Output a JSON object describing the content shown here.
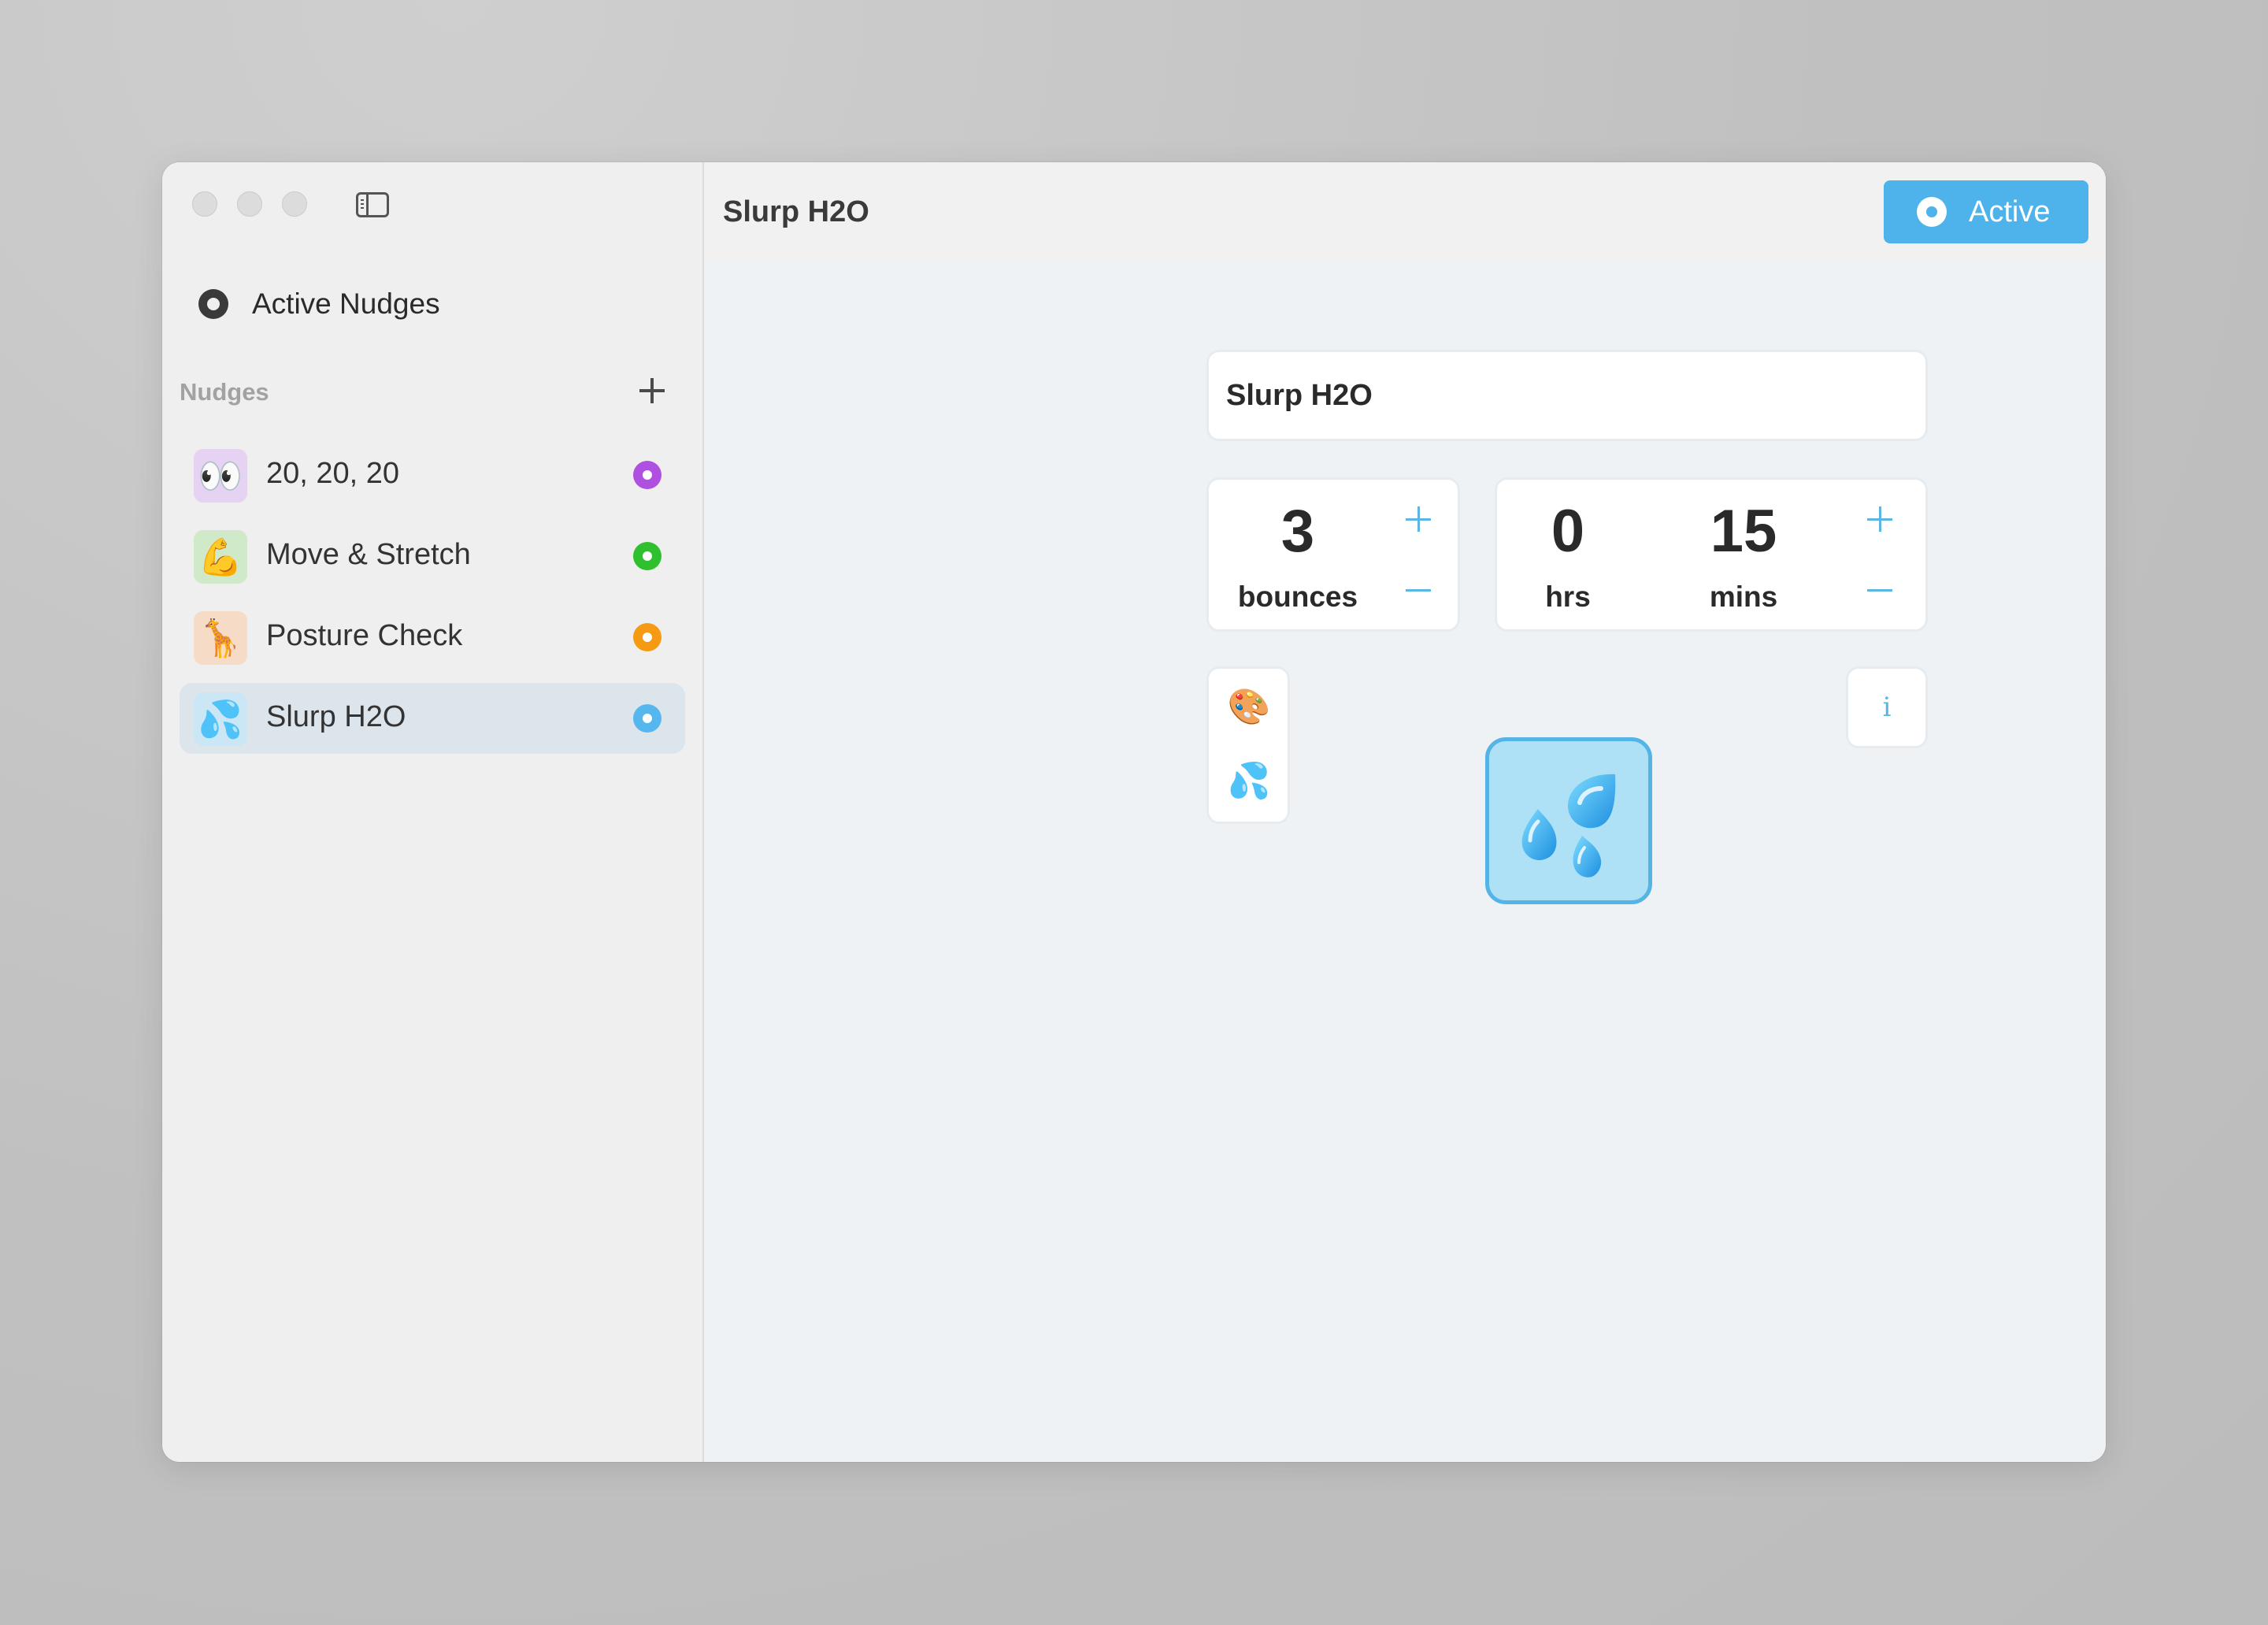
{
  "window": {
    "traffic_lights": [
      "close-button",
      "minimize-button",
      "zoom-button"
    ]
  },
  "sidebar": {
    "active_nudges_label": "Active Nudges",
    "section_title": "Nudges",
    "items": [
      {
        "emoji": "👀",
        "label": "20, 20, 20",
        "tile_color": "#e6d2f2",
        "dot_color": "#b050e0",
        "selected": false
      },
      {
        "emoji": "💪",
        "label": "Move & Stretch",
        "tile_color": "#cfe9c9",
        "dot_color": "#2ec02e",
        "selected": false
      },
      {
        "emoji": "🦒",
        "label": "Posture Check",
        "tile_color": "#f6dcc6",
        "dot_color": "#f59a12",
        "selected": false
      },
      {
        "emoji": "💦",
        "label": "Slurp H2O",
        "tile_color": "#cbe6f5",
        "dot_color": "#56b7ee",
        "selected": true
      }
    ]
  },
  "header": {
    "title": "Slurp H2O",
    "active_button_label": "Active",
    "accent_color": "#4db3ea"
  },
  "editor": {
    "name_value": "Slurp H2O",
    "bounces": {
      "value": "3",
      "unit": "bounces"
    },
    "hours": {
      "value": "0",
      "unit": "hrs"
    },
    "minutes": {
      "value": "15",
      "unit": "mins"
    },
    "tools": {
      "palette_icon": "🎨",
      "emoji_icon": "💦"
    },
    "info_label": "i",
    "preview_emoji": "💦"
  }
}
